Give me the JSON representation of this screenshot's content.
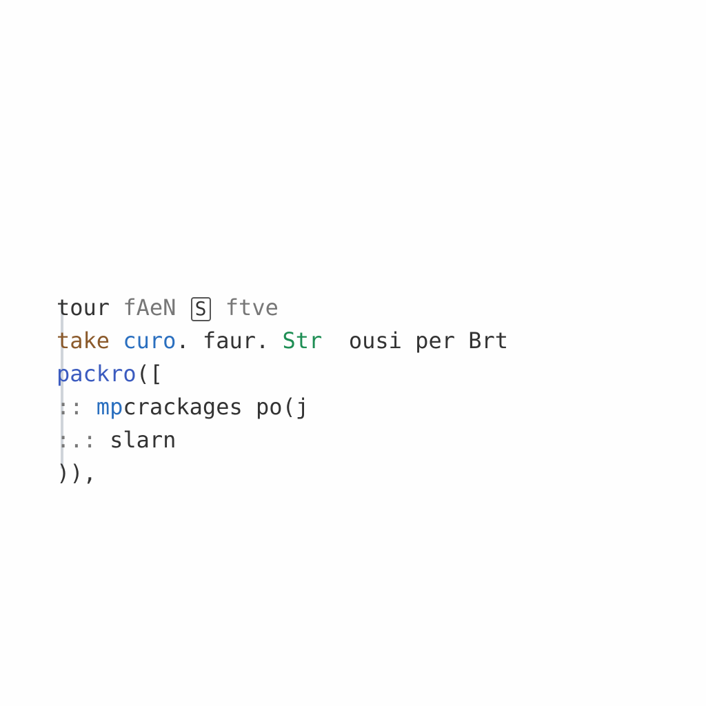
{
  "code": {
    "line1": {
      "t1": "tour ",
      "t2": "fAeN ",
      "t3_badge": "S",
      "t4": " ftve"
    },
    "line2": {
      "t1": "take ",
      "t2": "curo",
      "t3": ". faur. ",
      "t4": "Str",
      "t5": "  ousi per Brt"
    },
    "line3": {
      "t1": "packro",
      "t2": "([",
      "t3": ""
    },
    "line4": {
      "t1": ":: ",
      "t2": "mp",
      "t3": "crackages po(j"
    },
    "line5": {
      "t1": ":.: ",
      "t2": "slarn"
    },
    "line6": {
      "t1": ")),"
    }
  }
}
